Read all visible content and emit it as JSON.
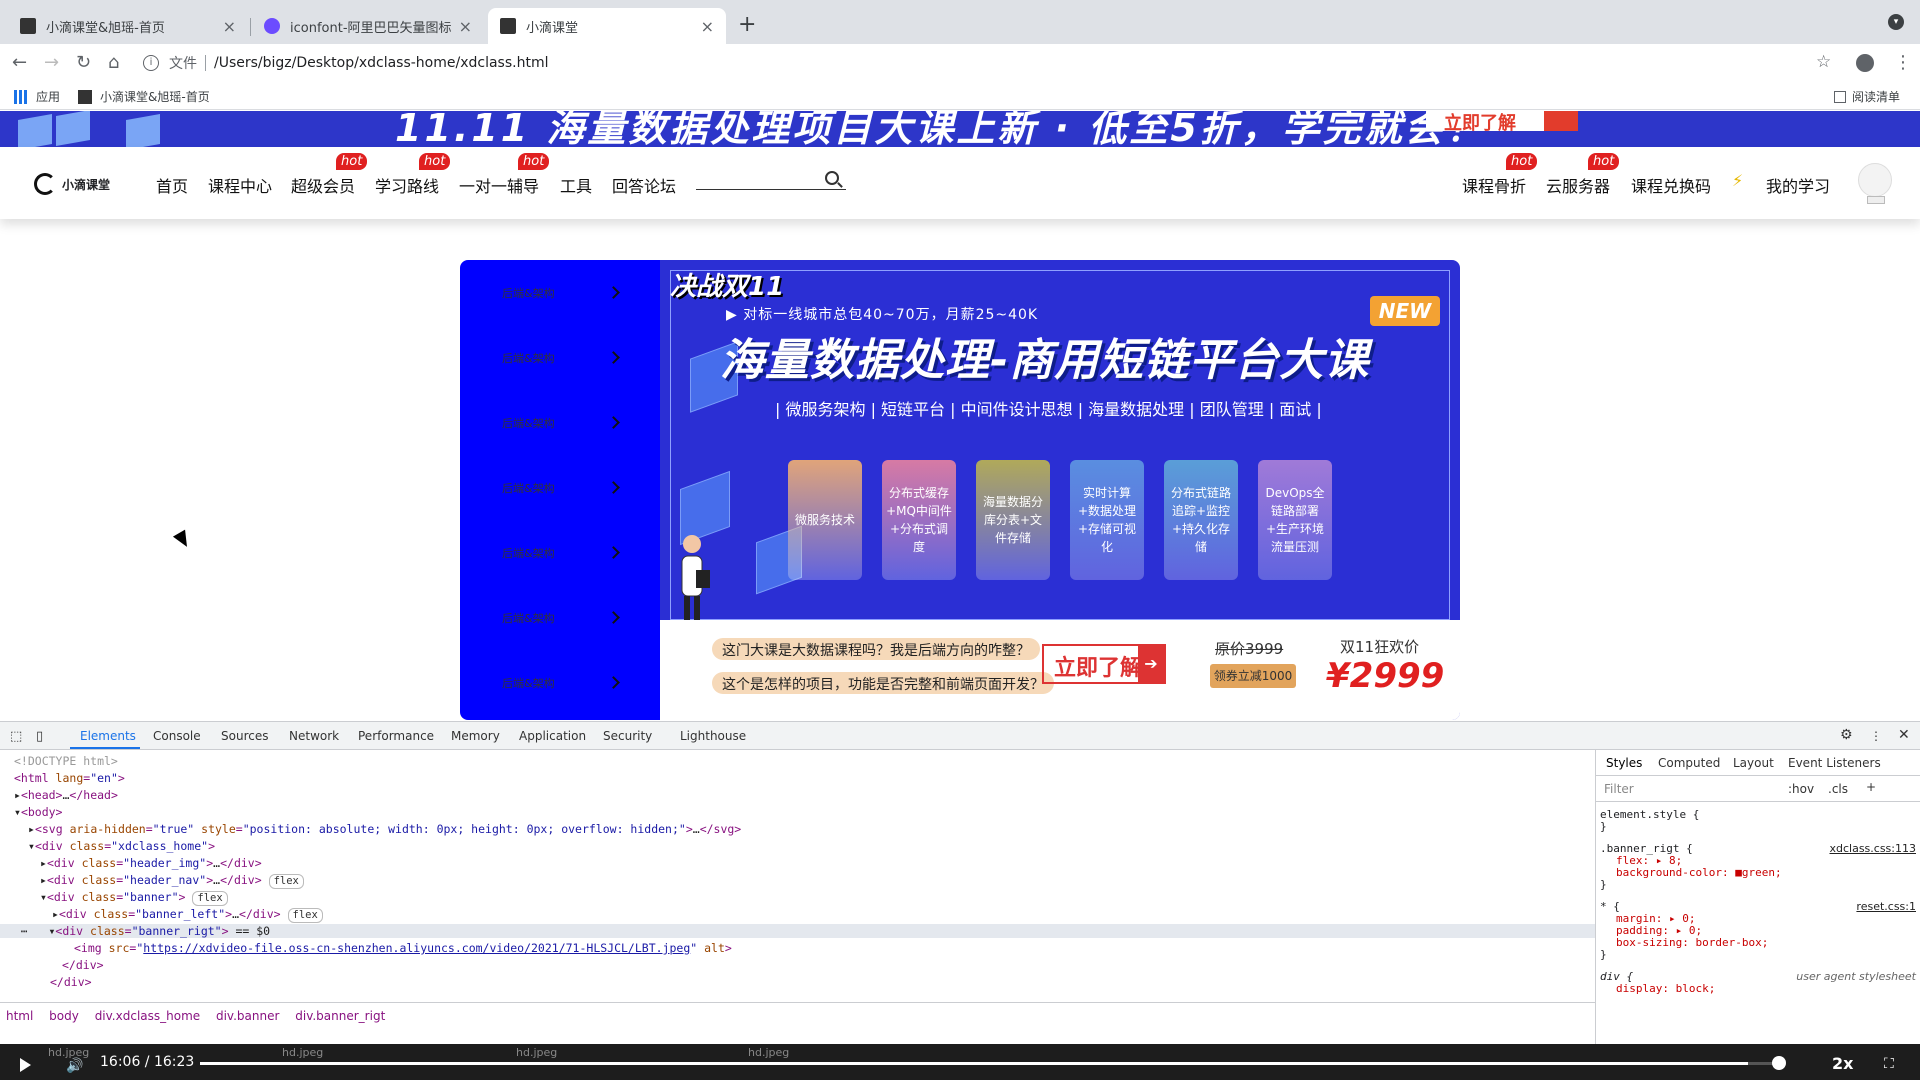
{
  "browser": {
    "tabs": [
      {
        "title": "小滴课堂&旭瑶-首页",
        "close": "×"
      },
      {
        "title": "iconfont-阿里巴巴矢量图标库",
        "close": "×"
      },
      {
        "title": "小滴课堂",
        "close": "×"
      }
    ],
    "new_tab": "+",
    "address": {
      "protocol": "文件",
      "url": "/Users/bigz/Desktop/xdclass-home/xdclass.html"
    },
    "bookmarks": [
      {
        "label": "应用"
      },
      {
        "label": "小滴课堂&旭瑶-首页"
      }
    ],
    "reading_list": "阅读清单"
  },
  "page": {
    "top_banner": {
      "text": "11.11 海量数据处理项目大课上新 · 低至5折，学完就会！",
      "button": "立即了解"
    },
    "logo": "小滴课堂",
    "nav_left": [
      {
        "label": "首页",
        "badge": ""
      },
      {
        "label": "课程中心",
        "badge": ""
      },
      {
        "label": "超级会员",
        "badge": "hot"
      },
      {
        "label": "学习路线",
        "badge": "hot"
      },
      {
        "label": "一对一辅导",
        "badge": "hot"
      },
      {
        "label": "工具",
        "badge": ""
      },
      {
        "label": "回答论坛",
        "badge": ""
      }
    ],
    "nav_right": [
      {
        "label": "课程骨折",
        "badge": "hot"
      },
      {
        "label": "云服务器",
        "badge": "hot"
      },
      {
        "label": "课程兑换码",
        "badge": ""
      },
      {
        "label": "我的学习",
        "badge": ""
      }
    ],
    "banner_left": [
      "后端&架构",
      "后端&架构",
      "后端&架构",
      "后端&架构",
      "后端&架构",
      "后端&架构",
      "后端&架构"
    ],
    "banner": {
      "fight": "决战双11",
      "subline": "▶ 对标一线城市总包40~70万，月薪25~40K",
      "new_badge": "NEW",
      "headline": "海量数据处理-商用短链平台大课",
      "tags": "| 微服务架构 | 短链平台 | 中间件设计思想 | 海量数据处理 | 团队管理 | 面试 |",
      "cards": [
        {
          "text": "微服务技术",
          "color": "#e0a47a"
        },
        {
          "text": "分布式缓存+MQ中间件+分布式调度",
          "color": "#d77aa4"
        },
        {
          "text": "海量数据分库分表+文件存储",
          "color": "#b0a95a"
        },
        {
          "text": "实时计算+数据处理+存储可视化",
          "color": "#5a8ee0"
        },
        {
          "text": "分布式链路追踪+监控+持久化存储",
          "color": "#5a9ed8"
        },
        {
          "text": "DevOps全链路部署+生产环境流量压测",
          "color": "#a07ad8"
        }
      ],
      "question1": "这门大课是大数据课程吗？我是后端方向的咋整？",
      "question2": "这个是怎样的项目，功能是否完整和前端页面开发？",
      "cta": "立即了解",
      "orig_price": "原价3999",
      "coupon": "领券立减1000",
      "promo_label": "双11狂欢价",
      "price": "¥2999"
    }
  },
  "devtools": {
    "tabs": [
      "Elements",
      "Console",
      "Sources",
      "Network",
      "Performance",
      "Memory",
      "Application",
      "Security",
      "Lighthouse"
    ],
    "breadcrumbs": [
      "html",
      "body",
      "div.xdclass_home",
      "div.banner",
      "div.banner_rigt"
    ],
    "styles_tabs": [
      "Styles",
      "Computed",
      "Layout",
      "Event Listeners"
    ],
    "filter_placeholder": "Filter",
    "hov": ":hov",
    "cls": ".cls",
    "dom": {
      "doctype": "<!DOCTYPE html>",
      "img_src": "https://xdvideo-file.oss-cn-shenzhen.aliyuncs.com/video/2021/71-HLSJCL/LBT.jpeg"
    },
    "styles": {
      "element_style": "element.style {",
      "rule1_selector": ".banner_rigt {",
      "rule1_source": "xdclass.css:113",
      "rule1_props": [
        "flex: ▸ 8;",
        "background-color: ■green;"
      ],
      "rule2_selector": "* {",
      "rule2_source": "reset.css:1",
      "rule2_props": [
        "margin: ▸ 0;",
        "padding: ▸ 0;",
        "box-sizing: border-box;"
      ],
      "rule3_selector": "div {",
      "rule3_source": "user agent stylesheet",
      "rule3_props": [
        "display: block;"
      ]
    }
  },
  "video": {
    "downloads": [
      "hd.jpeg",
      "hd.jpeg",
      "hd.jpeg",
      "hd.jpeg"
    ],
    "time": "16:06 / 16:23",
    "progress": 0.98,
    "speed": "2x"
  }
}
